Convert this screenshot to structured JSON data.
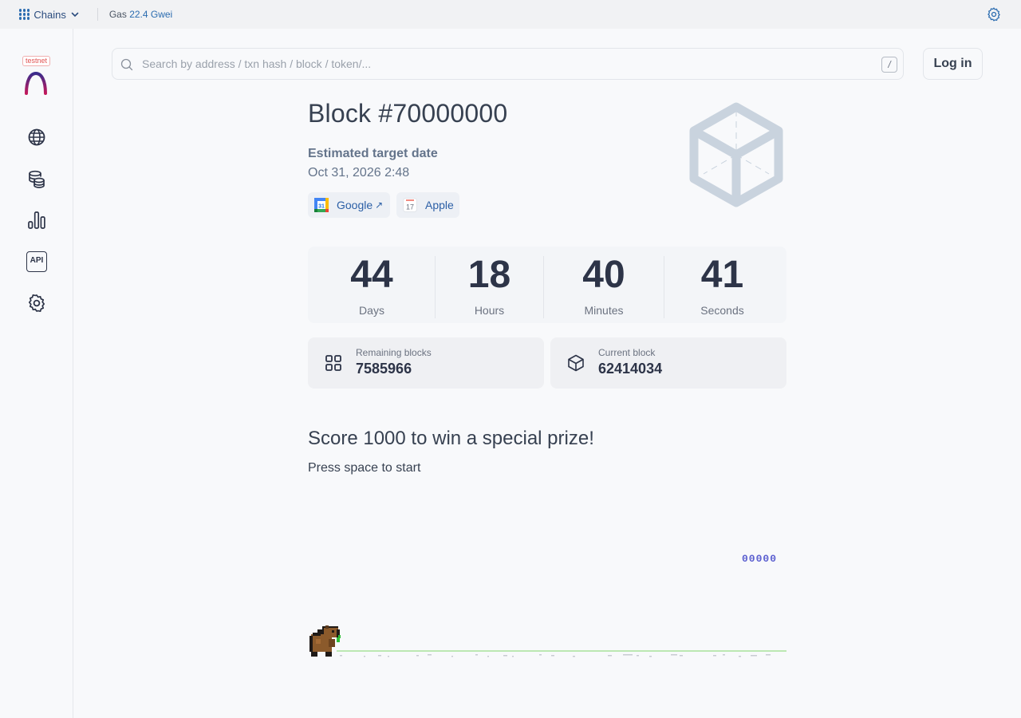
{
  "topbar": {
    "chains_label": "Chains",
    "gas_prefix": "Gas",
    "gas_value": "22.4 Gwei"
  },
  "sidebar": {
    "badge": "testnet",
    "items": [
      {
        "icon": "globe-icon"
      },
      {
        "icon": "coins-icon"
      },
      {
        "icon": "bar-chart-icon"
      },
      {
        "icon": "api-icon",
        "text": "API"
      },
      {
        "icon": "gear-icon"
      }
    ]
  },
  "search": {
    "placeholder": "Search by address / txn hash / block / token/...",
    "value": "",
    "shortcut": "/"
  },
  "header": {
    "login_label": "Log in"
  },
  "block": {
    "title": "Block #70000000",
    "estimated_label": "Estimated target date",
    "estimated_date": "Oct 31, 2026 2:48",
    "calendar_google": "Google",
    "calendar_google_arrow": "↗",
    "calendar_apple": "Apple",
    "calendar_icon_number": "31",
    "apple_icon_number": "17"
  },
  "countdown": [
    {
      "value": "44",
      "label": "Days"
    },
    {
      "value": "18",
      "label": "Hours"
    },
    {
      "value": "40",
      "label": "Minutes"
    },
    {
      "value": "41",
      "label": "Seconds"
    }
  ],
  "stats": {
    "remaining_label": "Remaining blocks",
    "remaining_value": "7585966",
    "current_label": "Current block",
    "current_value": "62414034"
  },
  "game": {
    "title": "Score 1000 to win a special prize!",
    "subtitle": "Press space to start",
    "score": "00000"
  },
  "colors": {
    "accent": "#2b6cb0",
    "link": "#2b5fa6",
    "ground": "#a8e29a",
    "score": "#5b5fd0",
    "capybara": "#8b5a2b"
  }
}
